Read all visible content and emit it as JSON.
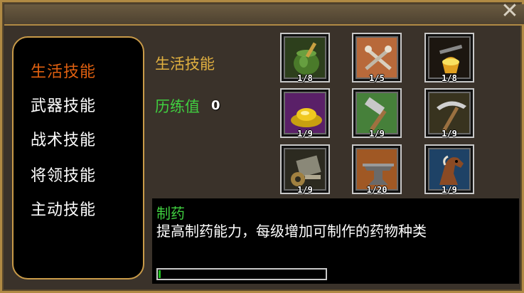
{
  "window": {
    "close_label": "✕"
  },
  "categories": [
    {
      "label": "生活技能",
      "active": true
    },
    {
      "label": "武器技能",
      "active": false
    },
    {
      "label": "战术技能",
      "active": false
    },
    {
      "label": "将领技能",
      "active": false
    },
    {
      "label": "主动技能",
      "active": false
    }
  ],
  "header": {
    "title": "生活技能",
    "exp_label": "历练值",
    "exp_value": "0"
  },
  "skills": [
    {
      "icon": "medicine-pot-icon",
      "level": "1/8"
    },
    {
      "icon": "crossed-tools-icon",
      "level": "1/5"
    },
    {
      "icon": "molten-crucible-icon",
      "level": "1/8"
    },
    {
      "icon": "gold-ingot-icon",
      "level": "1/9"
    },
    {
      "icon": "hammer-icon",
      "level": "1/9"
    },
    {
      "icon": "pickaxe-icon",
      "level": "1/9"
    },
    {
      "icon": "machinery-icon",
      "level": "1/9"
    },
    {
      "icon": "anvil-icon",
      "level": "1/20"
    },
    {
      "icon": "horse-icon",
      "level": "1/9"
    }
  ],
  "description": {
    "title": "制药",
    "text": "提高制药能力，每级增加可制作的药物种类",
    "progress": 0.01
  },
  "colors": {
    "active_category": "#e06010",
    "title_gold": "#e0b040",
    "green": "#40d040",
    "frame": "#b08a44"
  }
}
